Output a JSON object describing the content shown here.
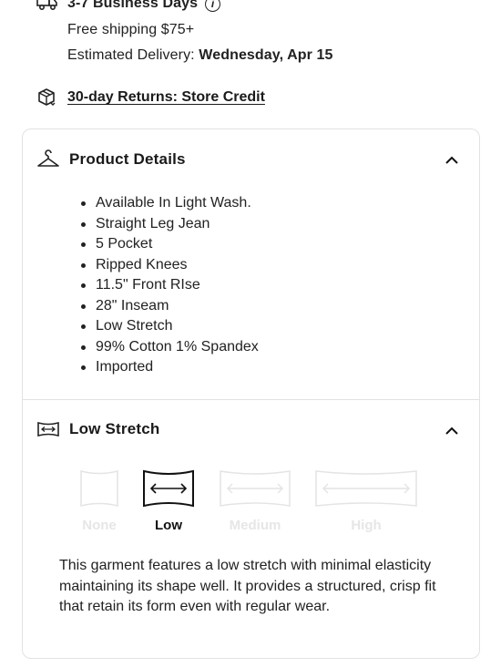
{
  "shipping": {
    "title": "3-7 Business Days",
    "info_icon": "info-icon",
    "free": "Free shipping $75+",
    "eta_label": "Estimated Delivery:",
    "eta_date": "Wednesday, Apr 15"
  },
  "returns": {
    "label": "30-day Returns: Store Credit",
    "icon": "package-return-icon"
  },
  "product_details": {
    "title": "Product Details",
    "icon": "hanger-icon",
    "items": [
      "Available In Light Wash.",
      "Straight Leg Jean",
      "5 Pocket",
      "Ripped Knees",
      "11.5\" Front RIse",
      "28\" Inseam",
      "Low Stretch",
      "99% Cotton 1% Spandex",
      "Imported"
    ]
  },
  "stretch": {
    "title": "Low Stretch",
    "icon": "stretch-icon",
    "options": [
      "None",
      "Low",
      "Medium",
      "High"
    ],
    "selected": "Low",
    "description": "This garment features a low stretch with minimal elasticity maintaining its shape well. It provides a structured, crisp fit that retain its form even with regular wear."
  },
  "colors": {
    "text": "#1a1a1a",
    "border": "#e2e2e2",
    "inactive": "#e6e6e6"
  }
}
